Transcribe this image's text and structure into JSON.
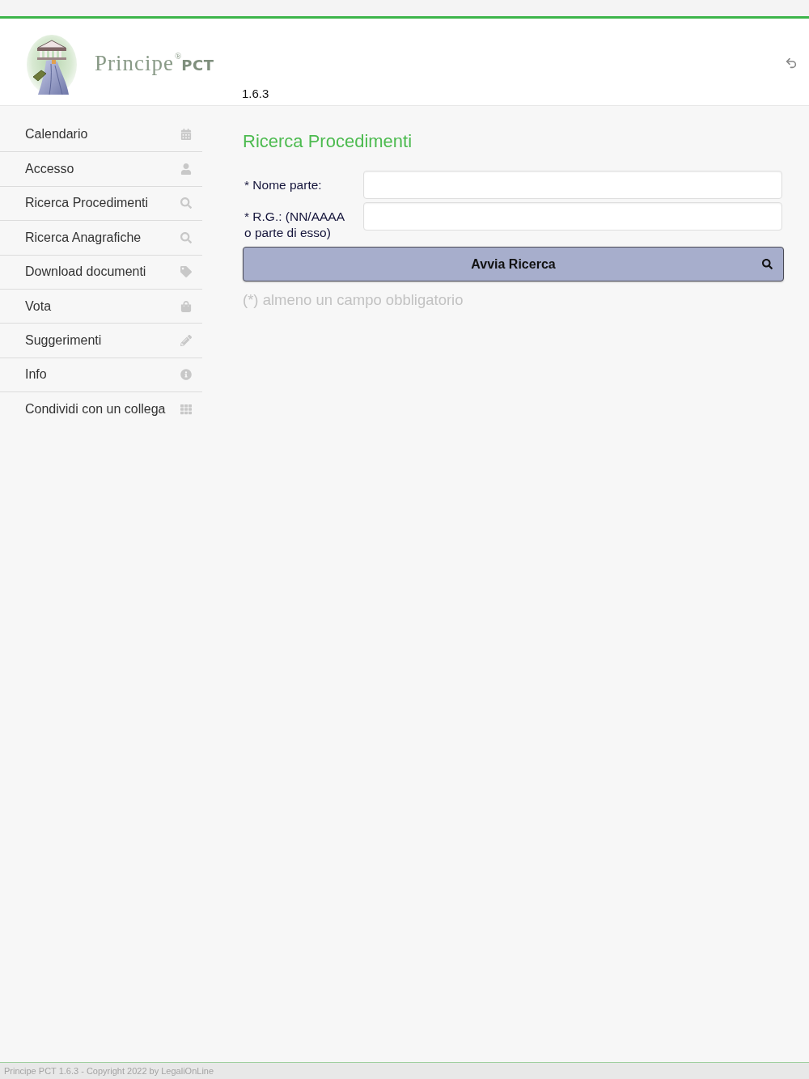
{
  "header": {
    "logo_text": "Principe$^{®}$**PCT**",
    "version": "1.6.3"
  },
  "sidebar": {
    "items": [
      {
        "label": "Calendario"
      },
      {
        "label": "Accesso"
      },
      {
        "label": "Ricerca Procedimenti"
      },
      {
        "label": "Ricerca Anagrafiche"
      },
      {
        "label": "Download documenti"
      },
      {
        "label": "Vota"
      },
      {
        "label": "Suggerimenti"
      },
      {
        "label": "Info"
      },
      {
        "label": "Condividi con un collega"
      }
    ]
  },
  "main": {
    "title": "Ricerca Procedimenti",
    "fields": [
      {
        "label": "* Nome parte:"
      },
      {
        "label": "* R.G.: (NN/AAAA o parte di esso)"
      }
    ],
    "search_button": {
      "label": "Avvia Ricerca"
    },
    "note": "(*) almeno un campo obbligatorio"
  },
  "footer": {
    "text": "Principe PCT 1.6.3 - Copyright 2022 by LegaliOnLine"
  }
}
